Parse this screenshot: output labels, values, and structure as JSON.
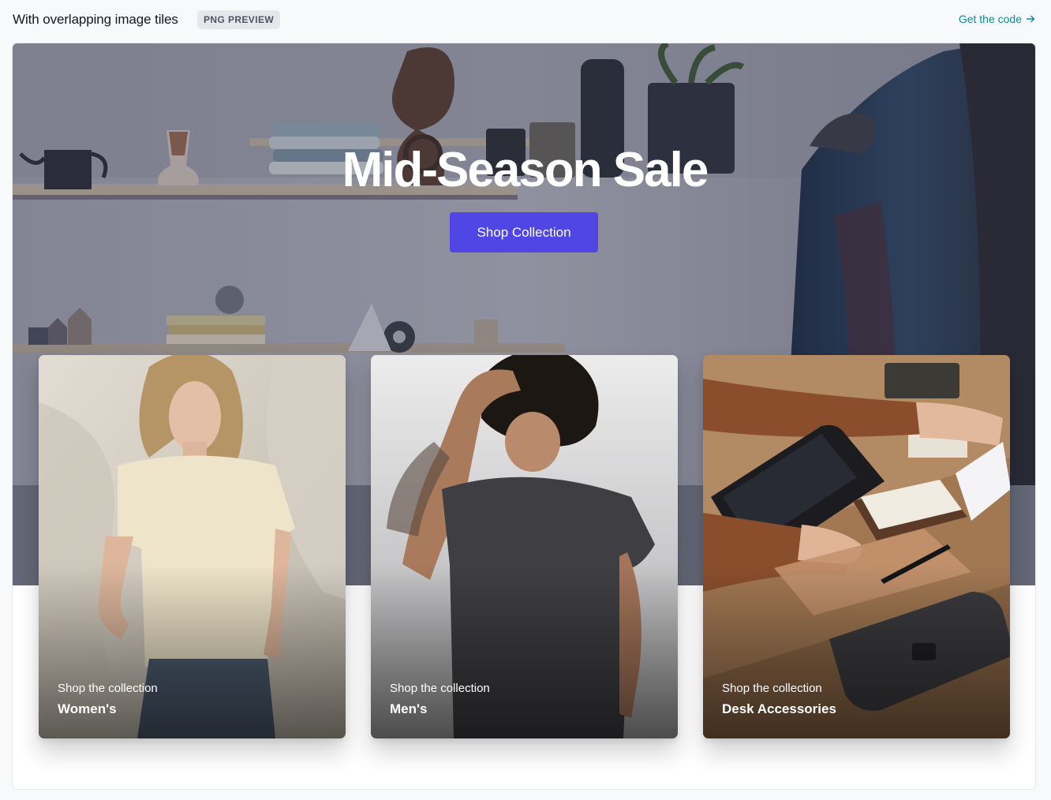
{
  "header": {
    "title": "With overlapping image tiles",
    "badge": "PNG PREVIEW",
    "code_link": "Get the code",
    "link_color": "#0e8a9a"
  },
  "hero": {
    "title": "Mid-Season Sale",
    "button_label": "Shop Collection",
    "button_color": "#4f46e5"
  },
  "collections": [
    {
      "subtitle": "Shop the collection",
      "name": "Women's",
      "image": "woman-in-cream-tshirt-photo"
    },
    {
      "subtitle": "Shop the collection",
      "name": "Men's",
      "image": "man-in-charcoal-tshirt-photo"
    },
    {
      "subtitle": "Shop the collection",
      "name": "Desk Accessories",
      "image": "desk-with-tablet-and-notepad-photo"
    }
  ]
}
